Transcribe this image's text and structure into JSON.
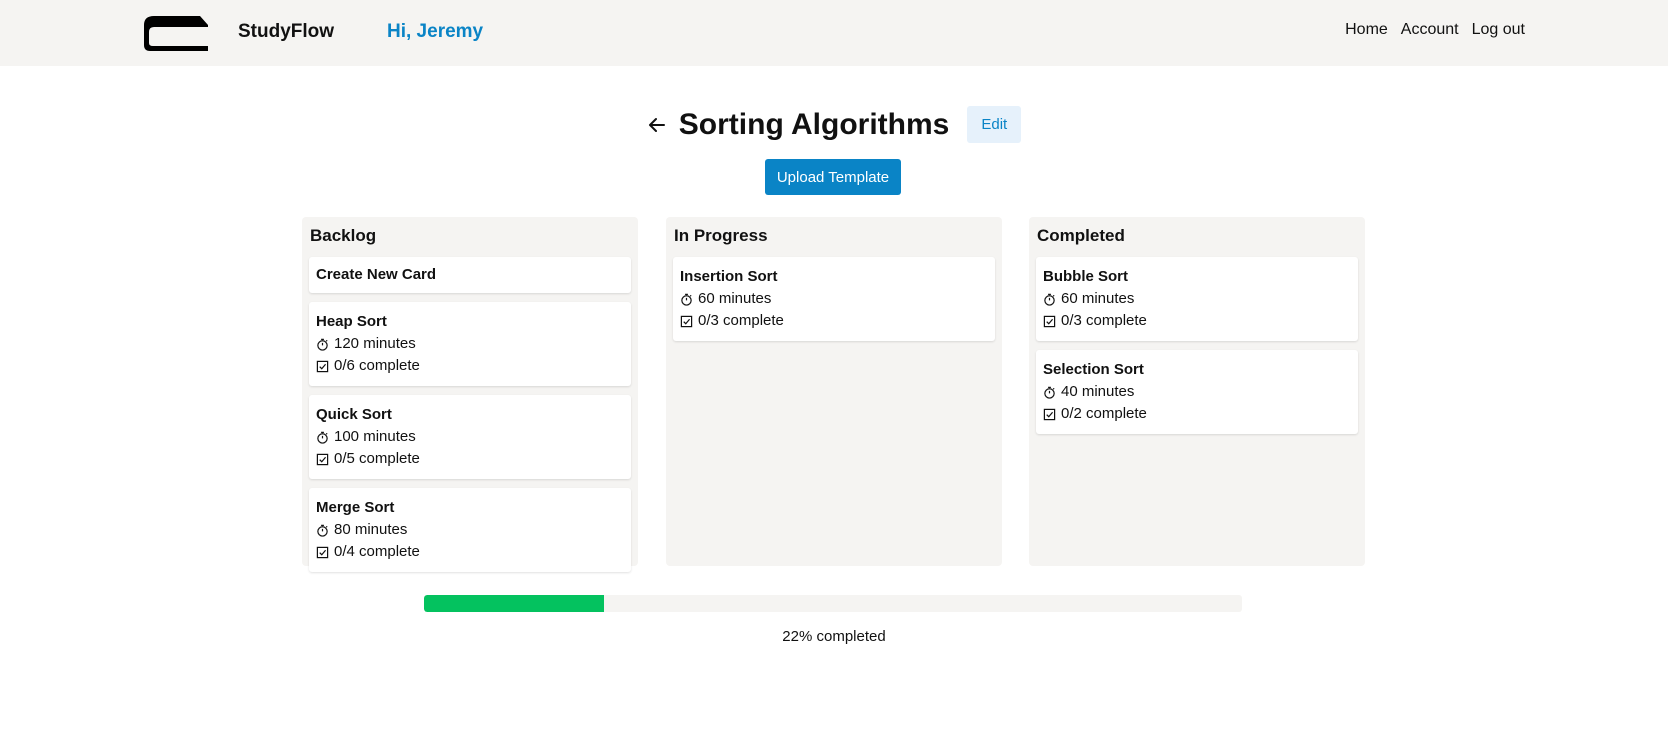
{
  "header": {
    "brand": "StudyFlow",
    "greeting": "Hi, Jeremy",
    "nav": [
      "Home",
      "Account",
      "Log out"
    ]
  },
  "page": {
    "title": "Sorting Algorithms",
    "edit_label": "Edit",
    "upload_label": "Upload Template"
  },
  "board": {
    "columns": [
      {
        "title": "Backlog",
        "new_card_label": "Create New Card",
        "cards": [
          {
            "title": "Heap Sort",
            "time": "120 minutes",
            "progress": "0/6 complete"
          },
          {
            "title": "Quick Sort",
            "time": "100 minutes",
            "progress": "0/5 complete"
          },
          {
            "title": "Merge Sort",
            "time": "80 minutes",
            "progress": "0/4 complete"
          }
        ]
      },
      {
        "title": "In Progress",
        "cards": [
          {
            "title": "Insertion Sort",
            "time": "60 minutes",
            "progress": "0/3 complete"
          }
        ]
      },
      {
        "title": "Completed",
        "cards": [
          {
            "title": "Bubble Sort",
            "time": "60 minutes",
            "progress": "0/3 complete"
          },
          {
            "title": "Selection Sort",
            "time": "40 minutes",
            "progress": "0/2 complete"
          }
        ]
      }
    ]
  },
  "progress": {
    "percent": 22,
    "label": "22% completed"
  },
  "colors": {
    "accent": "#0a84c6",
    "progress_fill": "#04c25f",
    "panel_bg": "#f5f4f2"
  },
  "icons": {
    "timer": "stopwatch-icon",
    "checklist": "checkbox-icon",
    "back": "arrow-left-icon"
  }
}
